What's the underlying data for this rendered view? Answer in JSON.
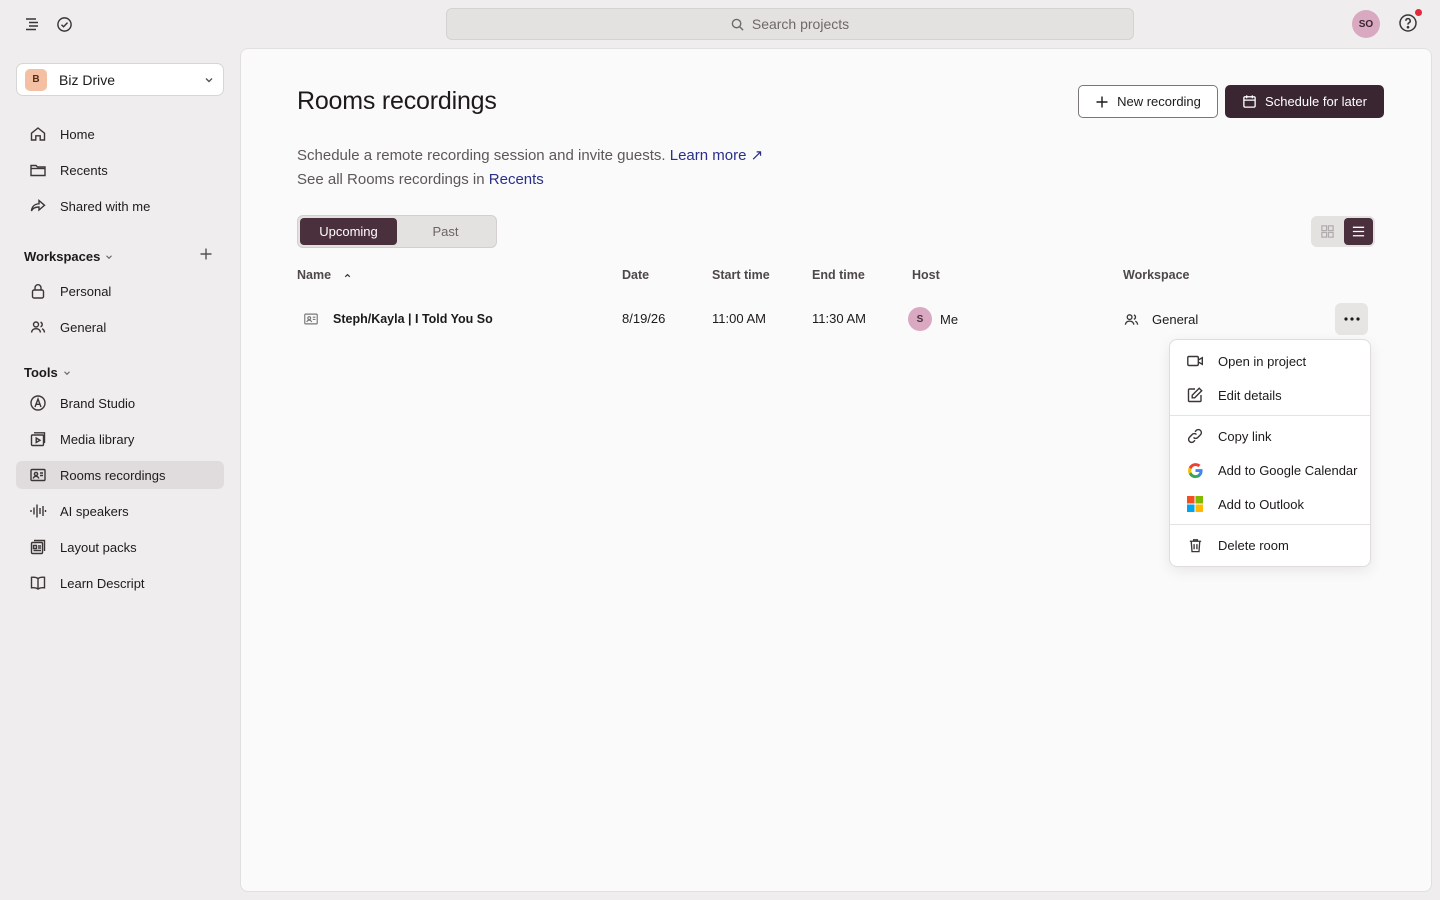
{
  "topbar": {
    "search_placeholder": "Search projects",
    "user_initials": "SO"
  },
  "sidebar": {
    "drive": {
      "badge": "B",
      "name": "Biz Drive"
    },
    "nav": [
      {
        "label": "Home",
        "icon": "home-icon"
      },
      {
        "label": "Recents",
        "icon": "folder-icon"
      },
      {
        "label": "Shared with me",
        "icon": "share-icon"
      }
    ],
    "workspaces_heading": "Workspaces",
    "workspaces": [
      {
        "label": "Personal",
        "icon": "lock-icon"
      },
      {
        "label": "General",
        "icon": "people-icon"
      }
    ],
    "tools_heading": "Tools",
    "tools": [
      {
        "label": "Brand Studio",
        "icon": "brand-icon"
      },
      {
        "label": "Media library",
        "icon": "media-library-icon"
      },
      {
        "label": "Rooms recordings",
        "icon": "rooms-icon",
        "active": true
      },
      {
        "label": "AI speakers",
        "icon": "waveform-icon"
      },
      {
        "label": "Layout packs",
        "icon": "layout-icon"
      },
      {
        "label": "Learn Descript",
        "icon": "book-icon"
      }
    ]
  },
  "main": {
    "title": "Rooms recordings",
    "new_recording_label": "New recording",
    "schedule_label": "Schedule for later",
    "desc_line1": "Schedule a remote recording session and invite guests.",
    "learn_more": "Learn more ↗",
    "desc_line2": "See all Rooms recordings in",
    "recents_link": "Recents",
    "tabs": [
      "Upcoming",
      "Past"
    ],
    "columns": {
      "name": "Name",
      "date": "Date",
      "start": "Start time",
      "end": "End time",
      "host": "Host",
      "workspace": "Workspace"
    },
    "rows": [
      {
        "name": "Steph/Kayla | I Told You So",
        "date": "8/19/26",
        "start": "11:00 AM",
        "end": "11:30 AM",
        "host_initial": "S",
        "host": "Me",
        "workspace": "General"
      }
    ]
  },
  "menu": {
    "items": [
      {
        "label": "Open in project",
        "icon": "video-camera-icon"
      },
      {
        "label": "Edit details",
        "icon": "edit-icon"
      },
      {
        "label": "Copy link",
        "icon": "link-icon"
      },
      {
        "label": "Add to Google Calendar",
        "icon": "google-icon"
      },
      {
        "label": "Add to Outlook",
        "icon": "microsoft-icon"
      },
      {
        "label": "Delete room",
        "icon": "trash-icon"
      }
    ]
  },
  "colors": {
    "accent": "#3a2631",
    "active_segment": "#4a2f3c",
    "link": "#2a2f8a",
    "notification": "#e02a3a"
  }
}
